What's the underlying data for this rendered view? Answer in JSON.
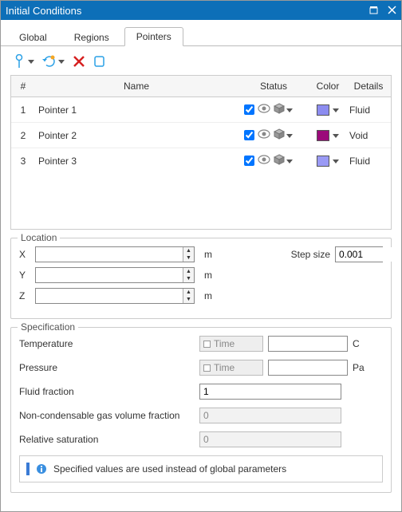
{
  "window": {
    "title": "Initial Conditions"
  },
  "tabs": {
    "global": "Global",
    "regions": "Regions",
    "pointers": "Pointers",
    "active": "pointers"
  },
  "icons": {
    "pointer": "pointer-icon",
    "add": "add-icon",
    "delete": "delete-icon",
    "copy": "copy-icon"
  },
  "table": {
    "headers": {
      "index": "#",
      "name": "Name",
      "status": "Status",
      "color": "Color",
      "details": "Details"
    },
    "rows": [
      {
        "idx": "1",
        "name": "Pointer 1",
        "checked": true,
        "color": "#8c8cf0",
        "details": "Fluid"
      },
      {
        "idx": "2",
        "name": "Pointer 2",
        "checked": true,
        "color": "#9b0a7a",
        "details": "Void"
      },
      {
        "idx": "3",
        "name": "Pointer 3",
        "checked": true,
        "color": "#9a9af5",
        "details": "Fluid"
      }
    ]
  },
  "location": {
    "label": "Location",
    "x_label": "X",
    "y_label": "Y",
    "z_label": "Z",
    "x_value": "",
    "y_value": "",
    "z_value": "",
    "unit": "m",
    "step_label": "Step size",
    "step_value": "0.001"
  },
  "spec": {
    "label": "Specification",
    "time_label": "Time",
    "temperature_label": "Temperature",
    "temperature_value": "",
    "temperature_unit": "C",
    "pressure_label": "Pressure",
    "pressure_value": "",
    "pressure_unit": "Pa",
    "fluid_fraction_label": "Fluid fraction",
    "fluid_fraction_value": "1",
    "ncg_label": "Non-condensable gas volume fraction",
    "ncg_value": "0",
    "relsat_label": "Relative saturation",
    "relsat_value": "0"
  },
  "note": {
    "text": "Specified values are used instead of global parameters"
  }
}
